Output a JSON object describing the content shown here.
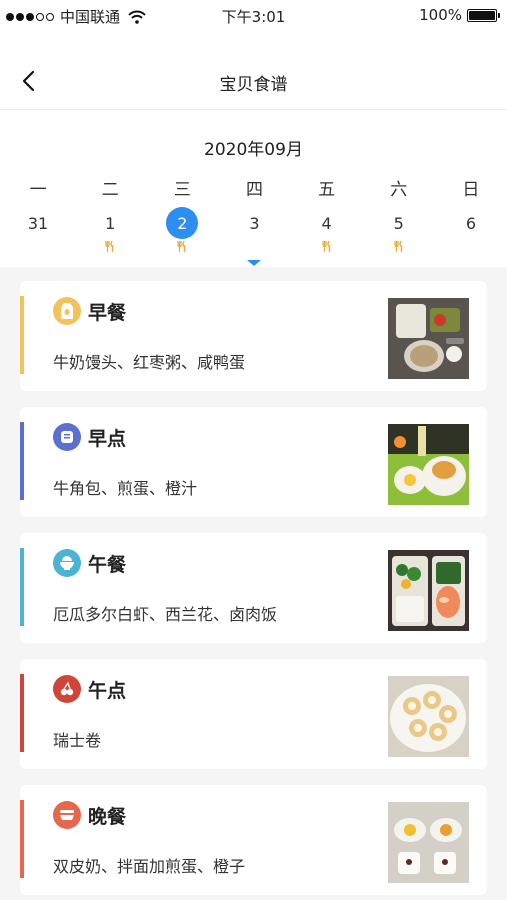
{
  "status_bar": {
    "carrier": "中国联通",
    "time": "下午3:01",
    "battery": "100%"
  },
  "nav": {
    "title": "宝贝食谱",
    "back_icon": "chevron-left-icon"
  },
  "calendar": {
    "month": "2020年09月",
    "weekdays": [
      "一",
      "二",
      "三",
      "四",
      "五",
      "六",
      "日"
    ],
    "dates": [
      {
        "day": "31",
        "has_meal": false,
        "selected": false
      },
      {
        "day": "1",
        "has_meal": true,
        "selected": false
      },
      {
        "day": "2",
        "has_meal": true,
        "selected": true
      },
      {
        "day": "3",
        "has_meal": false,
        "selected": false
      },
      {
        "day": "4",
        "has_meal": true,
        "selected": false
      },
      {
        "day": "5",
        "has_meal": true,
        "selected": false
      },
      {
        "day": "6",
        "has_meal": false,
        "selected": false
      }
    ],
    "accent_color": "#2b8ef0",
    "meal_mark_color": "#f0a92e"
  },
  "meals": [
    {
      "name": "早餐",
      "items": "牛奶馒头、红枣粥、咸鸭蛋",
      "color": "#f3c25a",
      "icon": "egg-box-icon",
      "photo": "breakfast-photo"
    },
    {
      "name": "早点",
      "items": "牛角包、煎蛋、橙汁",
      "color": "#5b6fd0",
      "icon": "bread-icon",
      "photo": "morning-snack-photo"
    },
    {
      "name": "午餐",
      "items": "厄瓜多尔白虾、西兰花、卤肉饭",
      "color": "#4bb3d4",
      "icon": "bowl-icon",
      "photo": "lunch-photo"
    },
    {
      "name": "午点",
      "items": "瑞士卷",
      "color": "#d0453a",
      "icon": "cherry-icon",
      "photo": "afternoon-snack-photo"
    },
    {
      "name": "晚餐",
      "items": "双皮奶、拌面加煎蛋、橙子",
      "color": "#e8674c",
      "icon": "dish-icon",
      "photo": "dinner-photo"
    }
  ]
}
